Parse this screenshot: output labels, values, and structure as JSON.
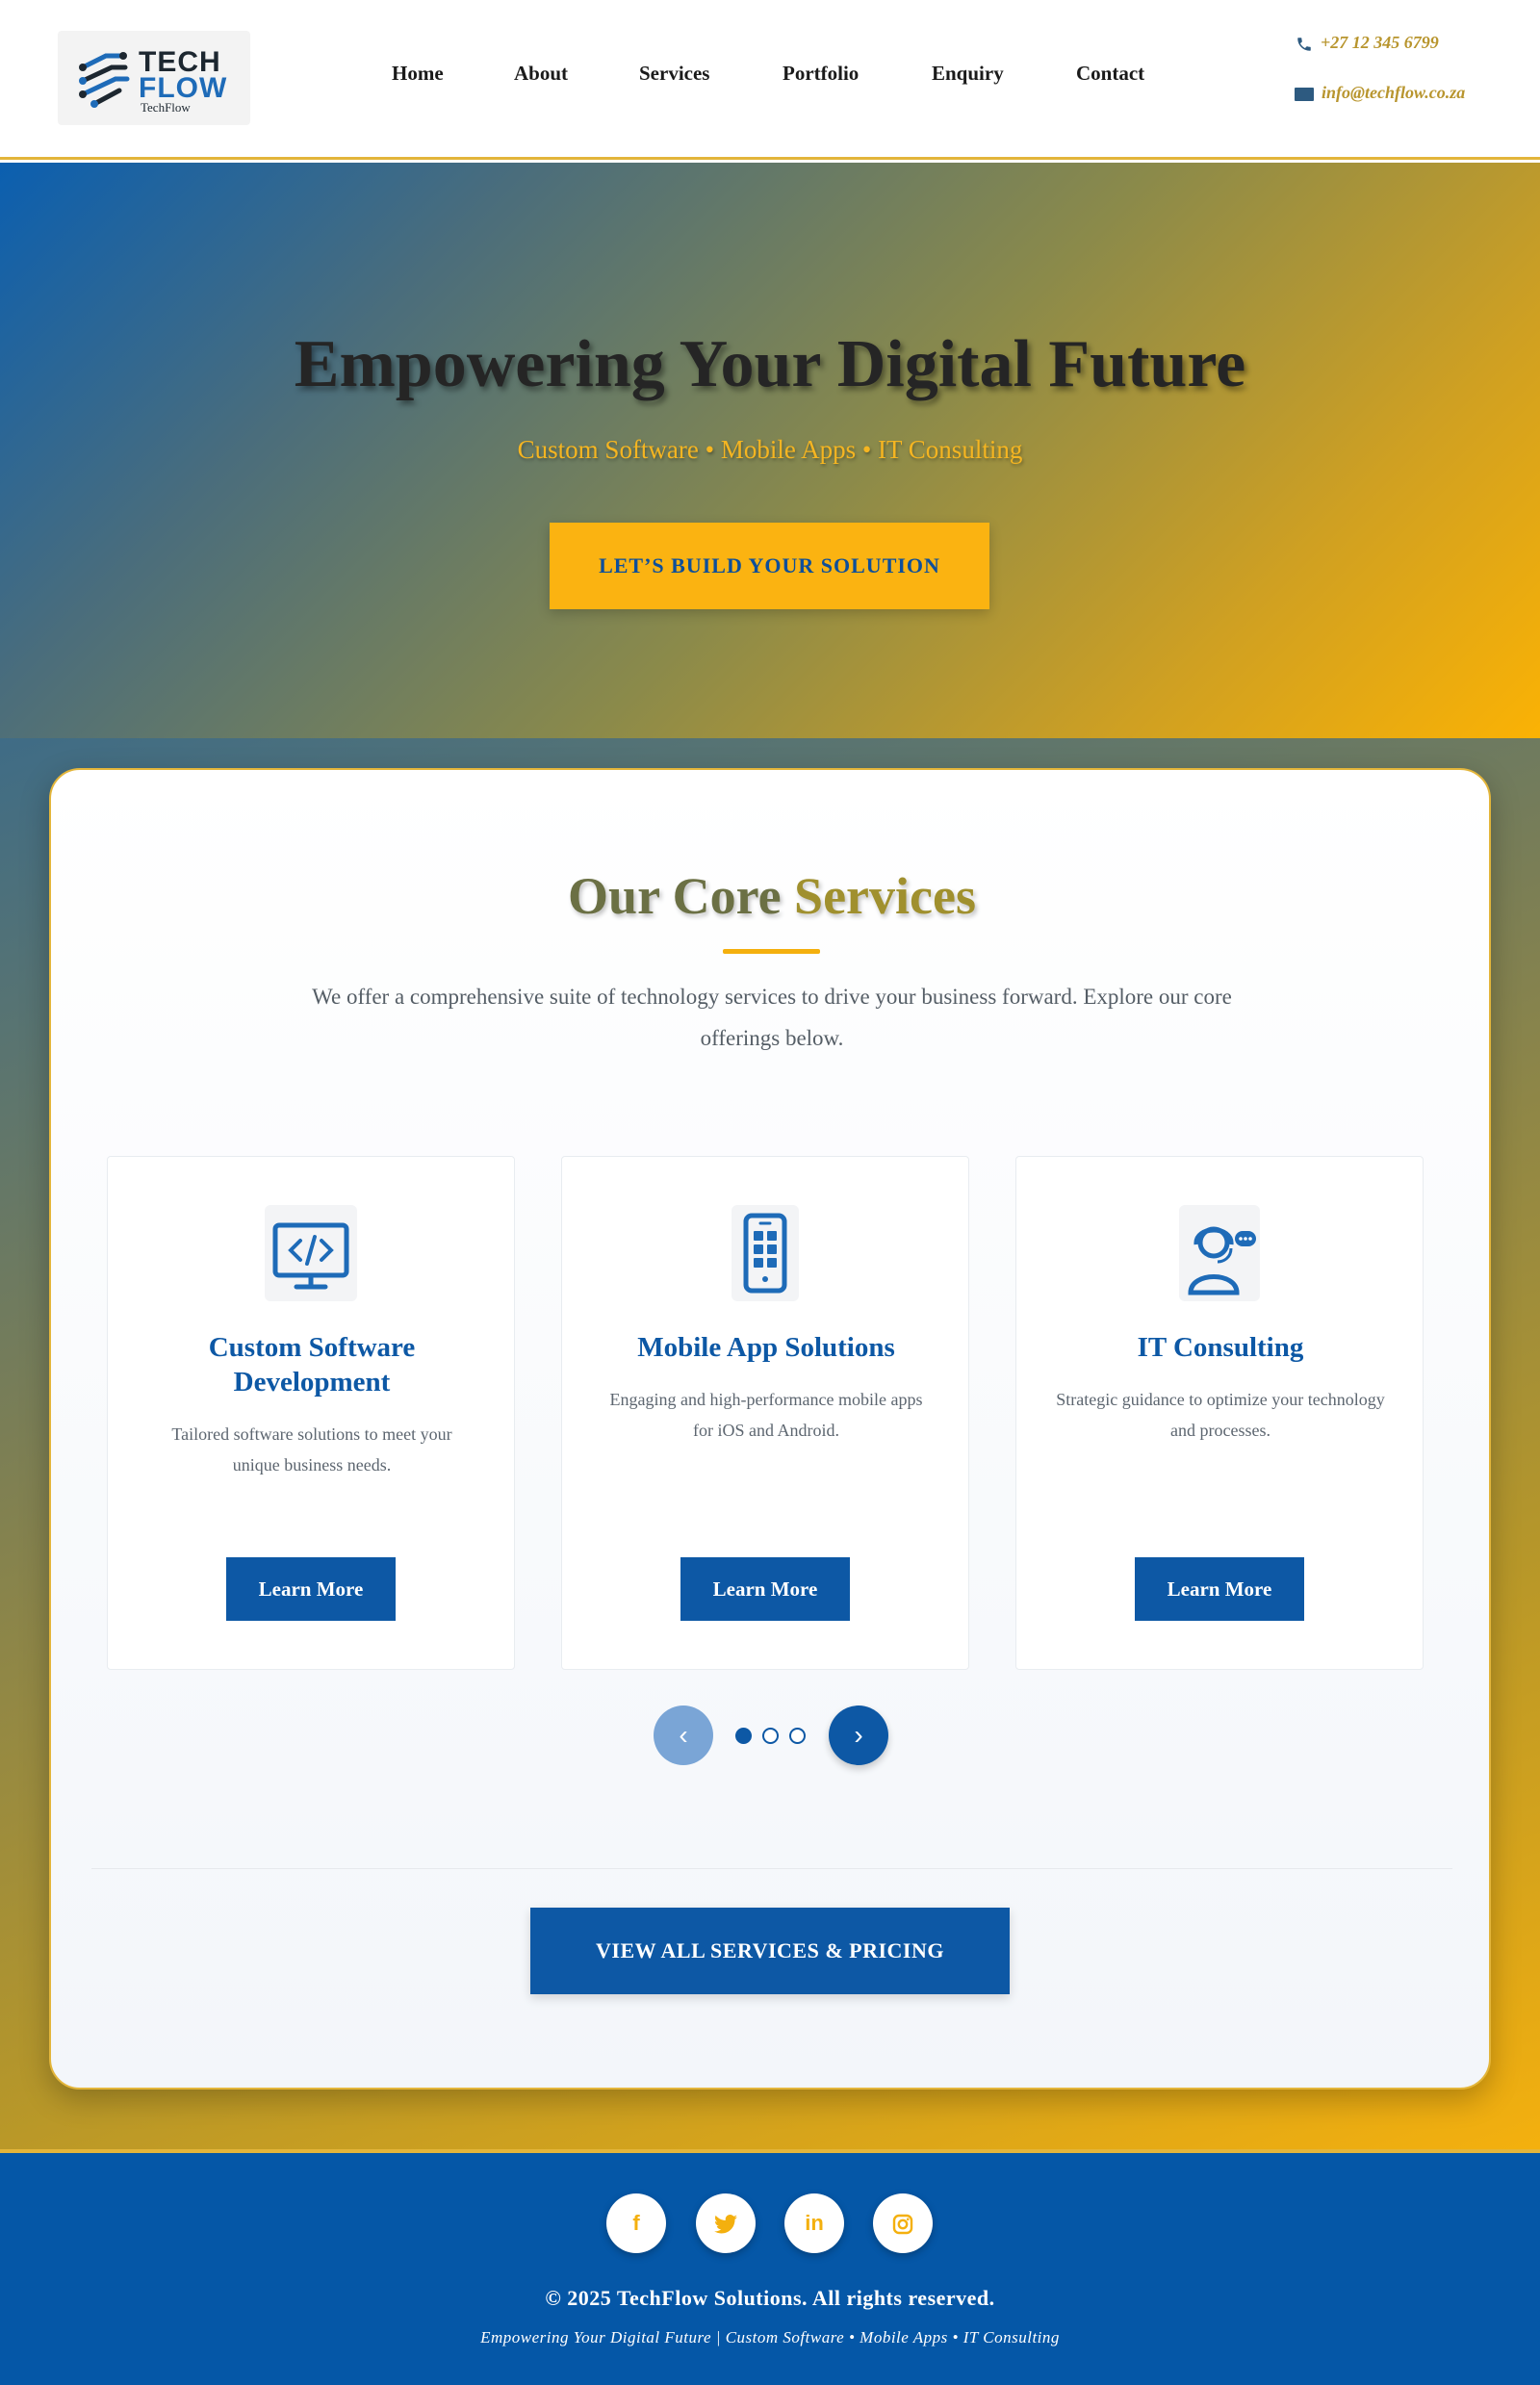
{
  "brand": {
    "logo_line1": "TECH",
    "logo_line2": "FLOW",
    "logo_small": "TechFlow"
  },
  "nav": {
    "items": [
      "Home",
      "About",
      "Services",
      "Portfolio",
      "Enquiry",
      "Contact"
    ]
  },
  "contact": {
    "phone": "+27 12 345 6799",
    "email": "info@techflow.co.za"
  },
  "hero": {
    "title": "Empowering Your Digital Future",
    "subtitle": "Custom Software • Mobile Apps • IT Consulting",
    "cta": "LET’S BUILD YOUR SOLUTION"
  },
  "services": {
    "title_part1": "Our Core ",
    "title_part2": "Services",
    "description": "We offer a comprehensive suite of technology services to drive your business forward. Explore our core offerings below.",
    "cards": [
      {
        "icon": "code-monitor-icon",
        "title": "Custom Software Development",
        "text": "Tailored software solutions to meet your unique business needs.",
        "button": "Learn More"
      },
      {
        "icon": "mobile-phone-icon",
        "title": "Mobile App Solutions",
        "text": "Engaging and high-performance mobile apps for iOS and Android.",
        "button": "Learn More"
      },
      {
        "icon": "support-agent-icon",
        "title": "IT Consulting",
        "text": "Strategic guidance to optimize your technology and processes.",
        "button": "Learn More"
      }
    ],
    "carousel": {
      "prev": "‹",
      "next": "›",
      "active_index": 0,
      "count": 3
    },
    "view_all": "VIEW ALL SERVICES & PRICING"
  },
  "footer": {
    "social": [
      {
        "icon": "facebook-icon",
        "glyph": "f"
      },
      {
        "icon": "twitter-icon",
        "glyph": "🐦"
      },
      {
        "icon": "linkedin-icon",
        "glyph": "in"
      },
      {
        "icon": "instagram-icon",
        "glyph": "◎"
      }
    ],
    "copyright": "© 2025 TechFlow Solutions. All rights reserved.",
    "tagline": "Empowering Your Digital Future | Custom Software • Mobile Apps • IT Consulting"
  },
  "colors": {
    "primary": "#0d58a5",
    "accent": "#f4b00e",
    "footer_bg": "#0557a7"
  }
}
